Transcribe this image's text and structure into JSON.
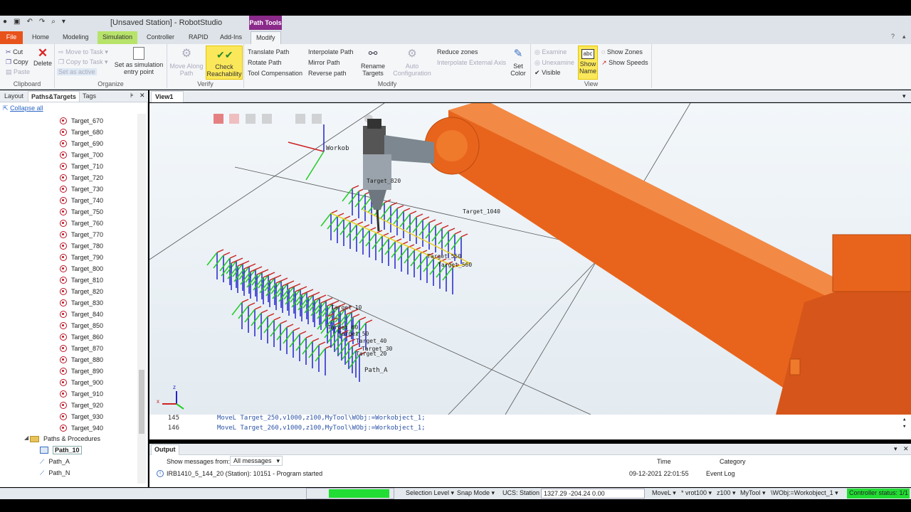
{
  "window": {
    "title": "[Unsaved Station] - RobotStudio",
    "context_tab": "Path Tools"
  },
  "tabs": [
    "File",
    "Home",
    "Modeling",
    "Simulation",
    "Controller",
    "RAPID",
    "Add-Ins",
    "Modify"
  ],
  "ribbon": {
    "clipboard": {
      "label": "Clipboard",
      "cut": "Cut",
      "copy": "Copy",
      "paste": "Paste",
      "delete": "Delete"
    },
    "organize": {
      "label": "Organize",
      "move_to_task": "Move to Task",
      "copy_to_task": "Copy to Task",
      "set_as_active": "Set as active",
      "set_entry": "Set as simulation entry point"
    },
    "verify": {
      "label": "Verify",
      "move_along": "Move Along Path",
      "check_reach": "Check Reachability"
    },
    "modify": {
      "label": "Modify",
      "translate": "Translate Path",
      "rotate": "Rotate Path",
      "tool_comp": "Tool Compensation",
      "interpolate": "Interpolate Path",
      "mirror": "Mirror Path",
      "reverse": "Reverse path",
      "rename": "Rename Targets",
      "auto_config": "Auto Configuration",
      "reduce_zones": "Reduce zones",
      "interp_ext": "Interpolate External Axis",
      "set_color": "Set Color"
    },
    "view": {
      "label": "View",
      "examine": "Examine",
      "unexamine": "Unexamine",
      "visible": "Visible",
      "show_name": "Show Name",
      "show_zones": "Show Zones",
      "show_speeds": "Show Speeds"
    }
  },
  "left_panel": {
    "tabs": [
      "Layout",
      "Paths&Targets",
      "Tags"
    ],
    "collapse_all": "Collapse all",
    "targets": [
      "Target_670",
      "Target_680",
      "Target_690",
      "Target_700",
      "Target_710",
      "Target_720",
      "Target_730",
      "Target_740",
      "Target_750",
      "Target_760",
      "Target_770",
      "Target_780",
      "Target_790",
      "Target_800",
      "Target_810",
      "Target_820",
      "Target_830",
      "Target_840",
      "Target_850",
      "Target_860",
      "Target_870",
      "Target_880",
      "Target_890",
      "Target_900",
      "Target_910",
      "Target_920",
      "Target_930",
      "Target_940"
    ],
    "paths_folder": "Paths & Procedures",
    "paths": [
      "Path_10",
      "Path_A",
      "Path_N"
    ]
  },
  "view": {
    "tab": "View1",
    "labels": [
      "Workob",
      "Target_10",
      "Target_20",
      "Target_30",
      "Target_40",
      "Target_50",
      "Target_60",
      "Path_A",
      "Target_550",
      "Target_560",
      "Target_1040",
      "Target_820"
    ]
  },
  "code": {
    "lines": [
      {
        "num": "145",
        "text": "MoveL Target_250,v1000,z100,MyTool\\WObj:=Workobject_1;"
      },
      {
        "num": "146",
        "text": "MoveL Target_260,v1000,z100,MyTool\\WObj:=Workobject_1;"
      }
    ]
  },
  "output": {
    "title": "Output",
    "show_from_label": "Show messages from:",
    "filter_value": "All messages",
    "col_time": "Time",
    "col_category": "Category",
    "message": "IRB1410_5_144_20 (Station): 10151 - Program started",
    "time": "09-12-2021 22:01:55",
    "category": "Event Log"
  },
  "status": {
    "selection_level": "Selection Level",
    "snap_mode": "Snap Mode",
    "ucs": "UCS: Station",
    "coords": "1327.29  -204.24  0.00",
    "move": "MoveL",
    "speed": "vrot100",
    "zone": "z100",
    "tool": "MyTool",
    "wobj": "\\WObj:=Workobject_1",
    "controller": "Controller status: 1/1"
  },
  "colors": {
    "file_tab": "#e8531c",
    "sim_tab": "#b7e36a",
    "context": "#8a2a8a",
    "robot": "#e8641c",
    "status_ok": "#22dd33"
  }
}
